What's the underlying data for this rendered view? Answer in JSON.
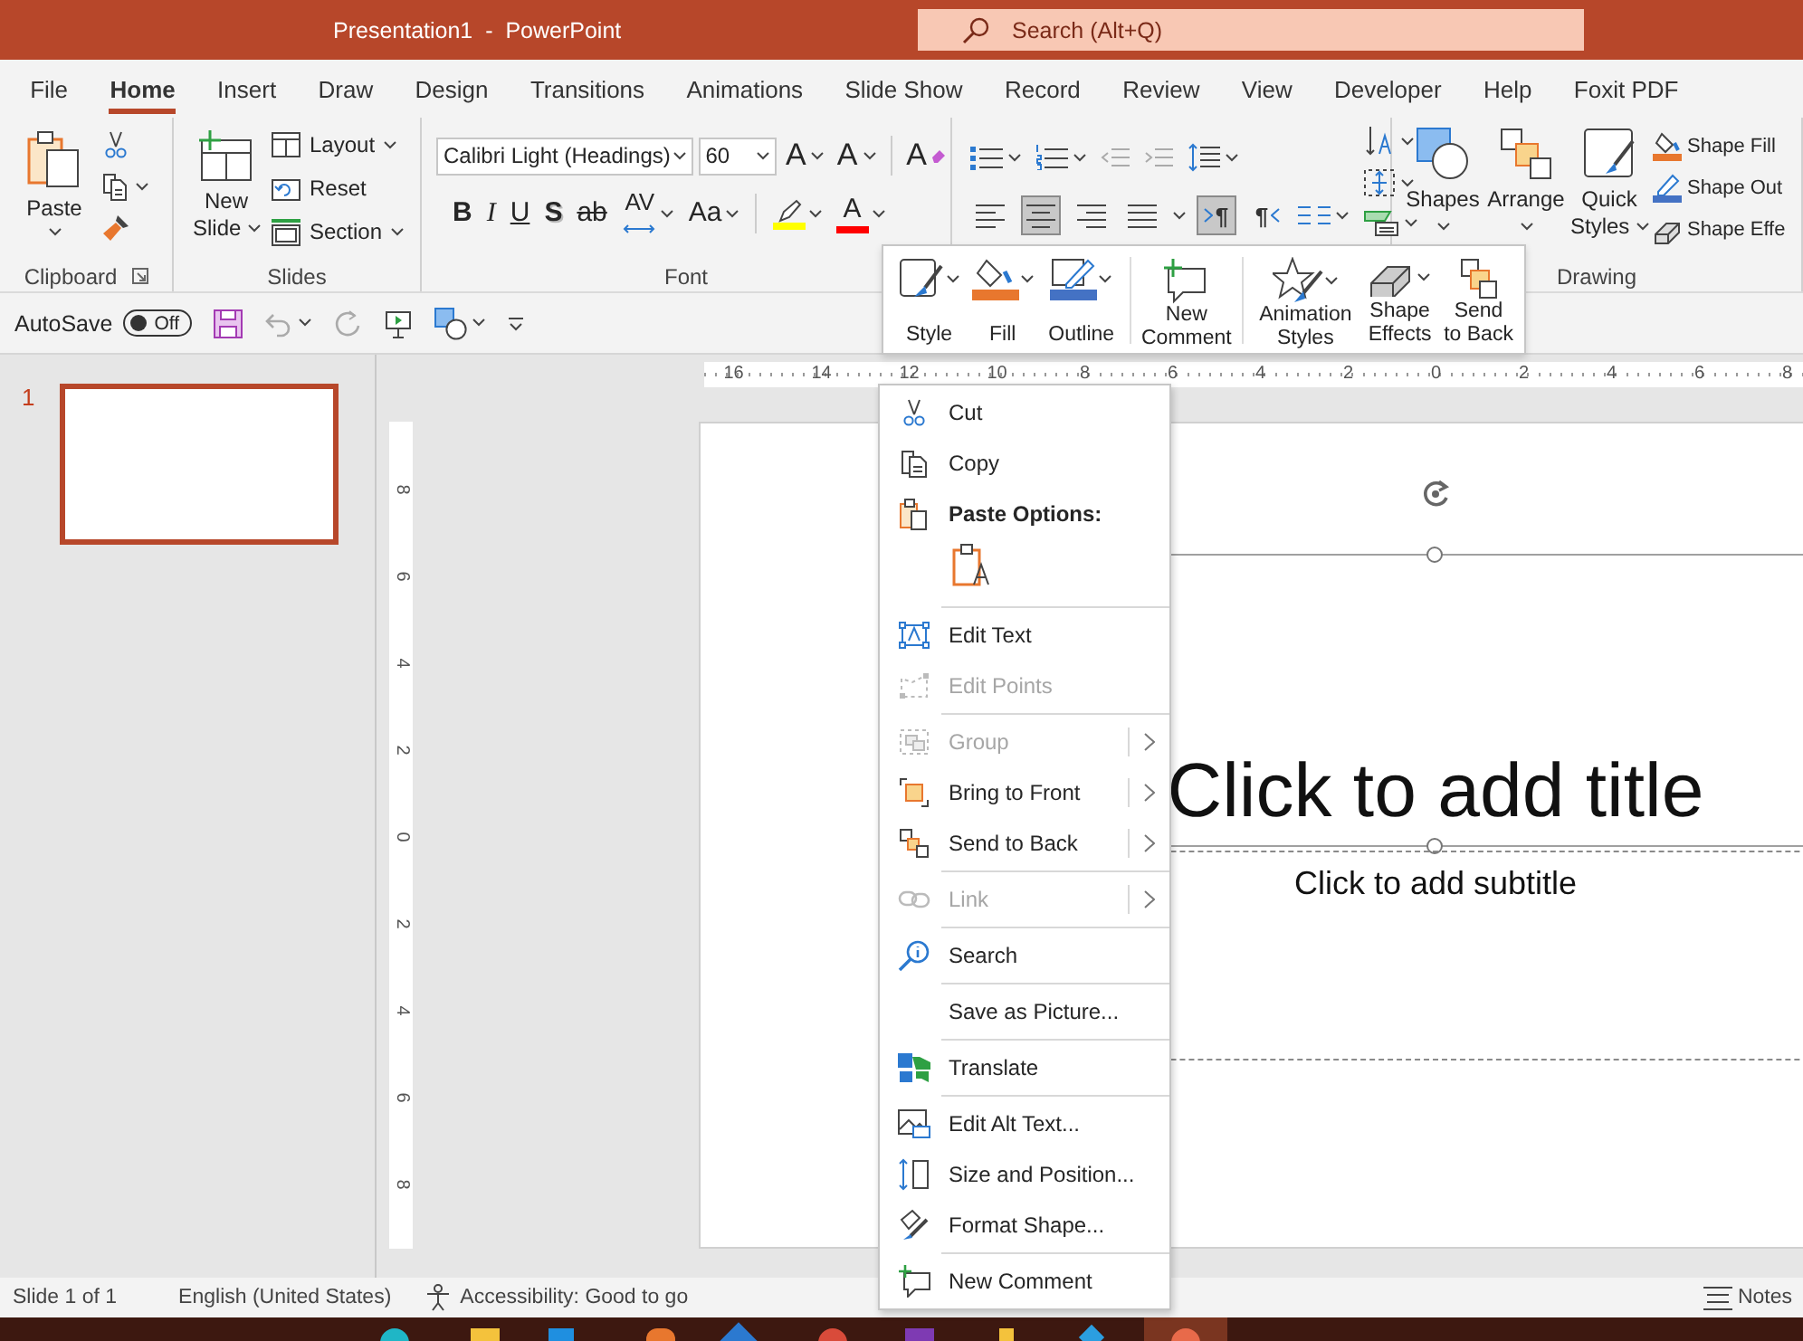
{
  "window": {
    "title": "Presentation1  -  PowerPoint"
  },
  "search": {
    "placeholder": "Search (Alt+Q)"
  },
  "tabs": [
    {
      "label": "File",
      "selected": false
    },
    {
      "label": "Home",
      "selected": true
    },
    {
      "label": "Insert",
      "selected": false
    },
    {
      "label": "Draw",
      "selected": false
    },
    {
      "label": "Design",
      "selected": false
    },
    {
      "label": "Transitions",
      "selected": false
    },
    {
      "label": "Animations",
      "selected": false
    },
    {
      "label": "Slide Show",
      "selected": false
    },
    {
      "label": "Record",
      "selected": false
    },
    {
      "label": "Review",
      "selected": false
    },
    {
      "label": "View",
      "selected": false
    },
    {
      "label": "Developer",
      "selected": false
    },
    {
      "label": "Help",
      "selected": false
    },
    {
      "label": "Foxit PDF",
      "selected": false
    }
  ],
  "ribbon": {
    "clipboard": {
      "label": "Clipboard",
      "paste": "Paste"
    },
    "slides": {
      "label": "Slides",
      "new_slide": "New Slide",
      "commands": [
        {
          "kind": "layout",
          "label": "Layout"
        },
        {
          "kind": "reset",
          "label": "Reset"
        },
        {
          "kind": "section",
          "label": "Section"
        }
      ]
    },
    "font": {
      "label": "Font",
      "font_name": "Calibri Light (Headings)",
      "font_size": "60",
      "size_buttons": [
        {
          "kind": "grow",
          "label": "A"
        },
        {
          "kind": "shrink",
          "label": "A"
        },
        {
          "kind": "clear",
          "label": "A"
        }
      ],
      "format_buttons": [
        {
          "kind": "bold",
          "label": "B"
        },
        {
          "kind": "italic",
          "label": "I"
        },
        {
          "kind": "underline",
          "label": "U"
        },
        {
          "kind": "shadow",
          "label": "S"
        },
        {
          "kind": "strike",
          "label": "ab"
        },
        {
          "kind": "spacing",
          "label": "AV"
        },
        {
          "kind": "case",
          "label": "Aa"
        },
        {
          "kind": "highlight",
          "color": "#ffff00"
        },
        {
          "kind": "color",
          "label": "A",
          "color": "#ff0000"
        }
      ]
    },
    "paragraph": {
      "alignment": [
        {
          "kind": "left",
          "selected": false
        },
        {
          "kind": "center",
          "selected": true
        },
        {
          "kind": "right",
          "selected": false
        },
        {
          "kind": "justify",
          "selected": false
        }
      ],
      "direction": [
        {
          "kind": "ltr",
          "label": "¶",
          "selected": true
        },
        {
          "kind": "rtl",
          "label": "¶",
          "selected": false
        }
      ]
    },
    "drawing": {
      "label": "Drawing",
      "big_buttons": [
        {
          "kind": "shapes",
          "label": "Shapes"
        },
        {
          "kind": "arrange",
          "label": "Arrange"
        },
        {
          "kind": "quick-styles",
          "label": "Quick Styles"
        }
      ],
      "small_buttons": [
        {
          "kind": "shape-fill",
          "label": "Shape Fill"
        },
        {
          "kind": "shape-outline",
          "label": "Shape Out"
        },
        {
          "kind": "shape-effects",
          "label": "Shape Effe"
        }
      ]
    }
  },
  "quick_access": {
    "autosave_label": "AutoSave",
    "autosave": {
      "on": false,
      "label": "Off"
    }
  },
  "mini_toolbar": {
    "groups": [
      [
        {
          "kind": "style",
          "label": "Style"
        },
        {
          "kind": "fill",
          "label": "Fill"
        },
        {
          "kind": "outline",
          "label": "Outline"
        }
      ],
      [
        {
          "kind": "comment",
          "label": "New Comment"
        }
      ],
      [
        {
          "kind": "animation",
          "label": "Animation Styles"
        },
        {
          "kind": "effects",
          "label": "Shape Effects"
        },
        {
          "kind": "send-back",
          "label": "Send to Back"
        }
      ]
    ]
  },
  "context_menu": {
    "sections": [
      [
        {
          "kind": "cut",
          "label": "Cut",
          "disabled": false,
          "submenu": false
        },
        {
          "kind": "copy",
          "label": "Copy",
          "disabled": false,
          "submenu": false
        },
        {
          "kind": "heading",
          "label": "Paste Options:",
          "disabled": false
        },
        {
          "kind": "paste-text",
          "disabled": false
        }
      ],
      [
        {
          "kind": "edit-text",
          "label": "Edit Text",
          "disabled": false,
          "submenu": false
        },
        {
          "kind": "edit-points",
          "label": "Edit Points",
          "disabled": true,
          "submenu": false
        }
      ],
      [
        {
          "kind": "group",
          "label": "Group",
          "disabled": true,
          "submenu": true
        },
        {
          "kind": "bring-front",
          "label": "Bring to Front",
          "disabled": false,
          "submenu": true
        },
        {
          "kind": "send-back",
          "label": "Send to Back",
          "disabled": false,
          "submenu": true
        }
      ],
      [
        {
          "kind": "link",
          "label": "Link",
          "disabled": true,
          "submenu": true
        }
      ],
      [
        {
          "kind": "search",
          "label": "Search",
          "disabled": false,
          "submenu": false
        }
      ],
      [
        {
          "kind": "save-picture",
          "label": "Save as Picture...",
          "disabled": false,
          "submenu": false
        }
      ],
      [
        {
          "kind": "translate",
          "label": "Translate",
          "disabled": false,
          "submenu": false
        }
      ],
      [
        {
          "kind": "alt-text",
          "label": "Edit Alt Text...",
          "disabled": false,
          "submenu": false
        },
        {
          "kind": "size",
          "label": "Size and Position...",
          "disabled": false,
          "submenu": false
        },
        {
          "kind": "format",
          "label": "Format Shape...",
          "disabled": false,
          "submenu": false
        }
      ],
      [
        {
          "kind": "comment",
          "label": "New Comment",
          "disabled": false,
          "submenu": false
        }
      ]
    ]
  },
  "slides_panel": {
    "slides": [
      {
        "number": "1",
        "selected": true
      }
    ]
  },
  "rulers": {
    "horizontal": [
      "16",
      "14",
      "12",
      "10",
      "8",
      "6",
      "4",
      "2",
      "0",
      "2",
      "4",
      "6",
      "8"
    ],
    "vertical": [
      "8",
      "6",
      "4",
      "2",
      "0",
      "2",
      "4",
      "6",
      "8"
    ]
  },
  "slide": {
    "title_placeholder": "Click to add title",
    "subtitle_placeholder": "Click to add subtitle"
  },
  "status_bar": {
    "slide": "Slide 1 of 1",
    "language": "English (United States)",
    "accessibility": "Accessibility: Good to go",
    "notes": "Notes"
  }
}
